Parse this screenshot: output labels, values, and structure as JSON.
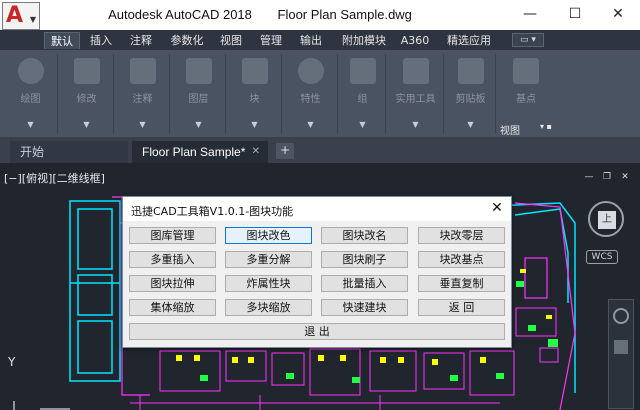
{
  "titlebar": {
    "app_name": "Autodesk AutoCAD 2018",
    "document": "Floor Plan Sample.dwg",
    "minimize": "—",
    "maximize": "☐",
    "close": "✕",
    "app_logo": "A"
  },
  "ribbon_tabs": [
    "默认",
    "插入",
    "注释",
    "参数化",
    "视图",
    "管理",
    "输出",
    "附加模块",
    "A360",
    "精选应用"
  ],
  "ribbon_groups": [
    "绘图",
    "修改",
    "注释",
    "图层",
    "块",
    "特性",
    "组",
    "实用工具",
    "剪贴板",
    "基点"
  ],
  "ribbon_view_label": "视图",
  "ribbon_view_controls": "▾ ▪",
  "doc_tabs": {
    "start": "开始",
    "active": "Floor Plan Sample*",
    "close": "✕",
    "plus": "+"
  },
  "viewport": {
    "label": "[−][俯视][二维线框]",
    "min": "—",
    "restore": "❐",
    "close": "✕",
    "cube_face": "上",
    "wcs": "WCS",
    "ucs_y": "Y"
  },
  "dialog": {
    "title": "迅捷CAD工具箱V1.0.1-图块功能",
    "close": "✕",
    "buttons": [
      [
        "图库管理",
        "图块改色",
        "图块改名",
        "块改零层"
      ],
      [
        "多重插入",
        "多重分解",
        "图块刷子",
        "块改基点"
      ],
      [
        "图块拉伸",
        "炸属性块",
        "批量插入",
        "垂直复制"
      ],
      [
        "集体缩放",
        "多块缩放",
        "快速建块",
        "返  回"
      ]
    ],
    "exit": "退    出"
  },
  "colors": {
    "canvas": "#21262e",
    "plan_cyan": "#00e5ff",
    "plan_magenta": "#ff33ff",
    "plan_yellow": "#ffff00",
    "plan_green": "#22ff44",
    "accent_red": "#c62828"
  }
}
